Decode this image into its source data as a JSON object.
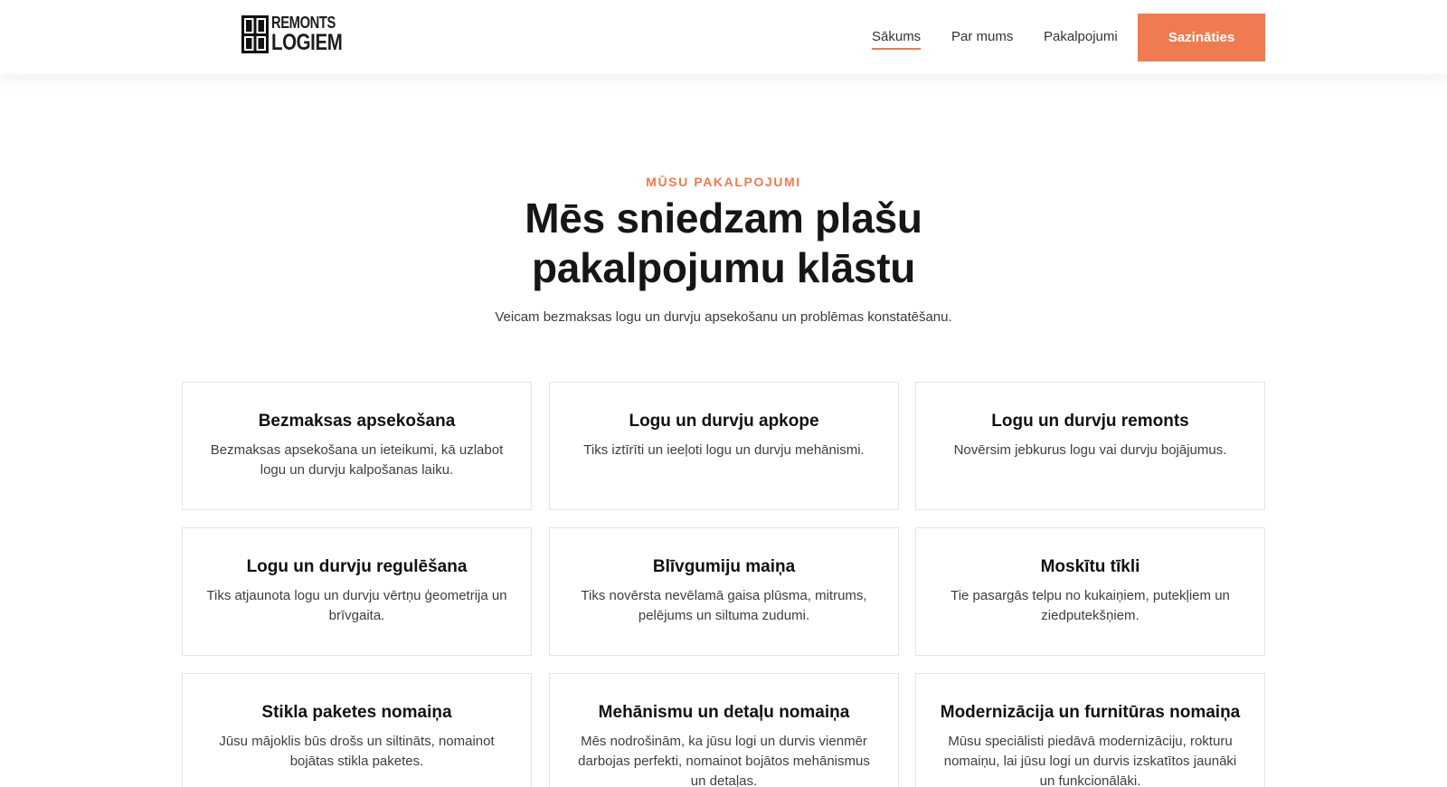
{
  "header": {
    "logo": {
      "line1": "REMONTS",
      "line2": "LOGIEM",
      "icon": "window-icon"
    },
    "nav": [
      {
        "label": "Sākums",
        "active": true
      },
      {
        "label": "Par mums",
        "active": false
      },
      {
        "label": "Pakalpojumi",
        "active": false
      }
    ],
    "cta_label": "Sazināties"
  },
  "section": {
    "eyebrow": "MŪSU PAKALPOJUMI",
    "title_line1": "Mēs sniedzam plašu",
    "title_line2": "pakalpojumu klāstu",
    "subtitle": "Veicam bezmaksas logu un durvju apsekošanu un problēmas konstatēšanu."
  },
  "services": [
    {
      "title": "Bezmaksas apsekošana",
      "desc": "Bezmaksas apsekošana un ieteikumi, kā uzlabot logu un durvju kalpošanas laiku."
    },
    {
      "title": "Logu un durvju apkope",
      "desc": "Tiks iztīrīti un ieeļoti logu un durvju mehānismi."
    },
    {
      "title": "Logu un durvju remonts",
      "desc": "Novērsim jebkurus logu vai durvju bojājumus."
    },
    {
      "title": "Logu un durvju regulēšana",
      "desc": "Tiks atjaunota logu un durvju vērtņu ģeometrija un brīvgaita."
    },
    {
      "title": "Blīvgumiju maiņa",
      "desc": "Tiks novērsta nevēlamā gaisa plūsma, mitrums, pelējums un siltuma zudumi."
    },
    {
      "title": "Moskītu tīkli",
      "desc": "Tie pasargās telpu no kukaiņiem, putekļiem un ziedputekšņiem."
    },
    {
      "title": "Stikla paketes nomaiņa",
      "desc": "Jūsu mājoklis būs drošs un siltināts, nomainot bojātas stikla paketes."
    },
    {
      "title": "Mehānismu un detaļu nomaiņa",
      "desc": "Mēs nodrošinām, ka jūsu logi un durvis vienmēr darbojas perfekti, nomainot bojātos mehānismus un detaļas."
    },
    {
      "title": "Modernizācija un furnitūras nomaiņa",
      "desc": "Mūsu speciālisti piedāvā modernizāciju, rokturu nomaiņu, lai jūsu logi un durvis izskatītos jaunāki un funkcionālāki."
    }
  ],
  "colors": {
    "accent": "#ef7b51",
    "text": "#161616",
    "border": "#e4e4e4"
  }
}
